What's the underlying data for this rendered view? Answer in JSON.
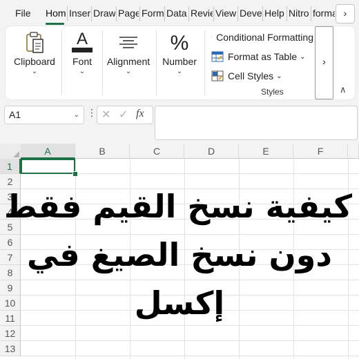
{
  "tabs": [
    {
      "label": "File",
      "active": false
    },
    {
      "label": "Home",
      "active": true
    },
    {
      "label": "Insert",
      "active": false
    },
    {
      "label": "Draw",
      "active": false
    },
    {
      "label": "Page Layout",
      "active": false
    },
    {
      "label": "Formulas",
      "active": false
    },
    {
      "label": "Data",
      "active": false
    },
    {
      "label": "Review",
      "active": false
    },
    {
      "label": "View",
      "active": false
    },
    {
      "label": "Developer",
      "active": false
    },
    {
      "label": "Help",
      "active": false
    },
    {
      "label": "Nitro",
      "active": false
    },
    {
      "label": "format",
      "active": false
    }
  ],
  "ribbon": {
    "clipboard": "Clipboard",
    "font": "Font",
    "alignment": "Alignment",
    "number": "Number",
    "conditional_formatting": "Conditional Formatting",
    "format_as_table": "Format as Table",
    "cell_styles": "Cell Styles",
    "styles_group": "Styles"
  },
  "formula_bar": {
    "name_box": "A1",
    "fx": "fx",
    "content": ""
  },
  "grid": {
    "columns": [
      "A",
      "B",
      "C",
      "D",
      "E",
      "F"
    ],
    "rows": [
      "1",
      "2",
      "3",
      "4",
      "5",
      "6",
      "7",
      "8",
      "9",
      "10",
      "11",
      "12",
      "13"
    ],
    "active_cell": "A1"
  },
  "overlay_text": {
    "line1": "كيفية نسخ القيم فقط",
    "line2": "دون نسخ الصيغ في",
    "line3": "إكسل"
  },
  "colors": {
    "accent": "#1e7145",
    "ribbon_bg": "#ffffff",
    "app_bg": "#f3f3f3"
  }
}
